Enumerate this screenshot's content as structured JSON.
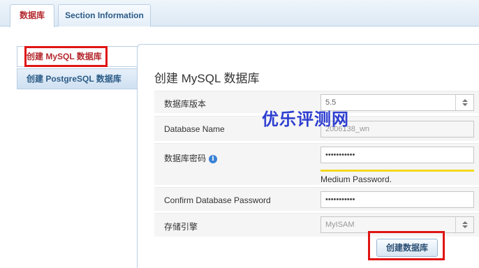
{
  "tabs": {
    "database": "数据库",
    "section_info": "Section Information"
  },
  "sidebar": {
    "items": [
      {
        "label": "创建 MySQL 数据库"
      },
      {
        "label": "创建 PostgreSQL 数据库"
      }
    ]
  },
  "form": {
    "title": "创建 MySQL 数据库",
    "version_label": "数据库版本",
    "version_value": "5.5",
    "dbname_label": "Database Name",
    "dbname_value": "2006138_wn",
    "password_label": "数据库密码",
    "info_icon_glyph": "i",
    "password_value": "•••••••••••",
    "password_strength": "Medium Password.",
    "password_strength_color": "#f3d81c",
    "confirm_label": "Confirm Database Password",
    "confirm_value": "•••••••••••",
    "engine_label": "存储引擎",
    "engine_value": "MyISAM",
    "submit_label": "创建数据库"
  },
  "watermark": "优乐评测网",
  "colors": {
    "accent_red": "#b4292e",
    "link_blue": "#2b5b86",
    "highlight": "#e01414",
    "watermark": "#2f3fd1"
  }
}
